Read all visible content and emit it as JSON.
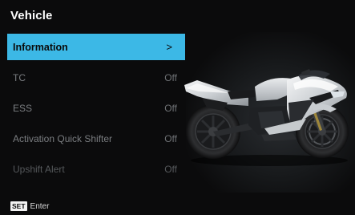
{
  "header": {
    "title": "Vehicle"
  },
  "menu": {
    "items": [
      {
        "label": "Information",
        "value": ">"
      },
      {
        "label": "TC",
        "value": "Off"
      },
      {
        "label": "ESS",
        "value": "Off"
      },
      {
        "label": "Activation Quick Shifter",
        "value": "Off"
      },
      {
        "label": "Upshift Alert",
        "value": "Off"
      }
    ]
  },
  "footer": {
    "key": "SET",
    "action": "Enter"
  },
  "colors": {
    "accent": "#3cb8e6",
    "background": "#0b0b0c"
  },
  "icons": {
    "motorcycle": "motorcycle-image"
  }
}
